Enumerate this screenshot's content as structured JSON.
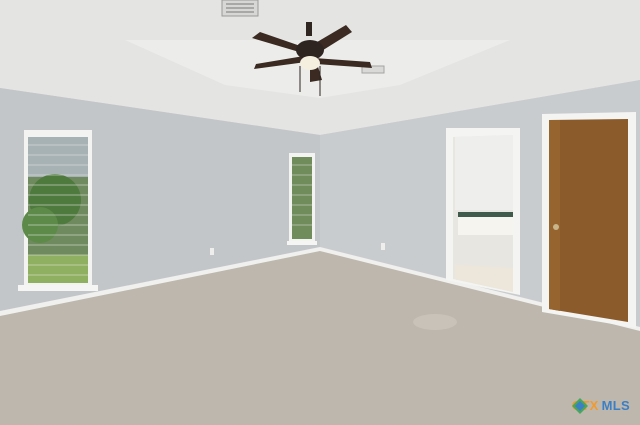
{
  "scene": {
    "subject": "empty-bedroom",
    "colors": {
      "ceiling": "#e3e3e1",
      "wall": "#c4c7ca",
      "carpet": "#bdb6ad",
      "baseboard": "#f2f2f0",
      "door": "#8a5a2a",
      "fan": "#3a2e28",
      "window_glass": "#5a7a4a",
      "bath_floor": "#ece6dc"
    }
  },
  "watermark": {
    "brand_part1": "CTX",
    "brand_part2": "MLS"
  }
}
